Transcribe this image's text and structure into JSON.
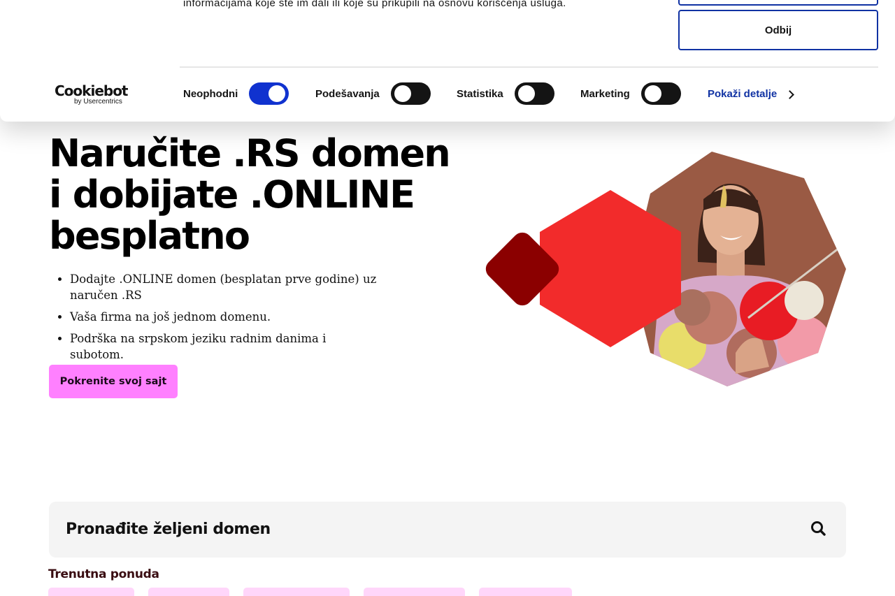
{
  "cookie_banner": {
    "description_tail": "informacijama koje ste im dali ili koje su prikupili na osnovu korišćenja usluga.",
    "deny_button": "Odbij",
    "logo": {
      "main": "Cookiebot",
      "sub": "by Usercentrics"
    },
    "toggles": [
      {
        "label": "Neophodni",
        "checked": true
      },
      {
        "label": "Podešavanja",
        "checked": false
      },
      {
        "label": "Statistika",
        "checked": false
      },
      {
        "label": "Marketing",
        "checked": false
      }
    ],
    "details_link": "Pokaži detalje",
    "colors": {
      "accent": "#1032cf",
      "border": "#1032a3"
    }
  },
  "hero": {
    "title_lines": [
      "Naručite .RS domen",
      "i dobijate .ONLINE",
      "besplatno"
    ],
    "benefits": [
      "Dodajte .ONLINE domen (besplatan prve godine) uz naručen .RS",
      "Vaša firma na još jednom domenu.",
      "Podrška na srpskom jeziku radnim danima i subotom."
    ],
    "cta_label": "Pokrenite svoj sajt",
    "colors": {
      "cta": "#ff80ff",
      "hexagon": "#f22b2b",
      "diamond": "#8b0000",
      "photo_bg": "#9a5a44"
    }
  },
  "search": {
    "placeholder": "Pronađite željeni domen",
    "icon": "search-icon"
  },
  "offers": {
    "heading": "Trenutna ponuda",
    "chip_color": "#ffd6fa"
  }
}
